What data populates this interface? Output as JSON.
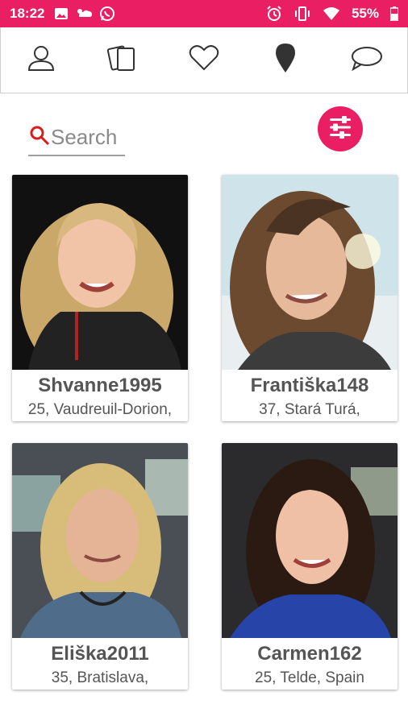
{
  "status_bar": {
    "time": "18:22",
    "battery_percent": "55%",
    "left_icons": [
      "image-icon",
      "weather-icon",
      "whatsapp-icon"
    ],
    "right_icons": [
      "alarm-icon",
      "vibrate-icon",
      "wifi-icon",
      "battery-icon"
    ],
    "color": "#e91e63"
  },
  "top_nav": {
    "items": [
      {
        "icon": "profile-icon"
      },
      {
        "icon": "cards-icon"
      },
      {
        "icon": "heart-icon"
      },
      {
        "icon": "location-pin-icon"
      },
      {
        "icon": "chat-bubble-icon"
      }
    ]
  },
  "search": {
    "placeholder": "Search",
    "icon": "search-icon"
  },
  "filter_button": {
    "icon": "sliders-icon",
    "color": "#e91e63"
  },
  "profiles": [
    {
      "username": "Shvanne1995",
      "details": "25, Vaudreuil-Dorion,"
    },
    {
      "username": "Františka148",
      "details": "37, Stará Turá,"
    },
    {
      "username": "Eliška2011",
      "details": "35, Bratislava,"
    },
    {
      "username": "Carmen162",
      "details": "25, Telde, Spain"
    }
  ]
}
